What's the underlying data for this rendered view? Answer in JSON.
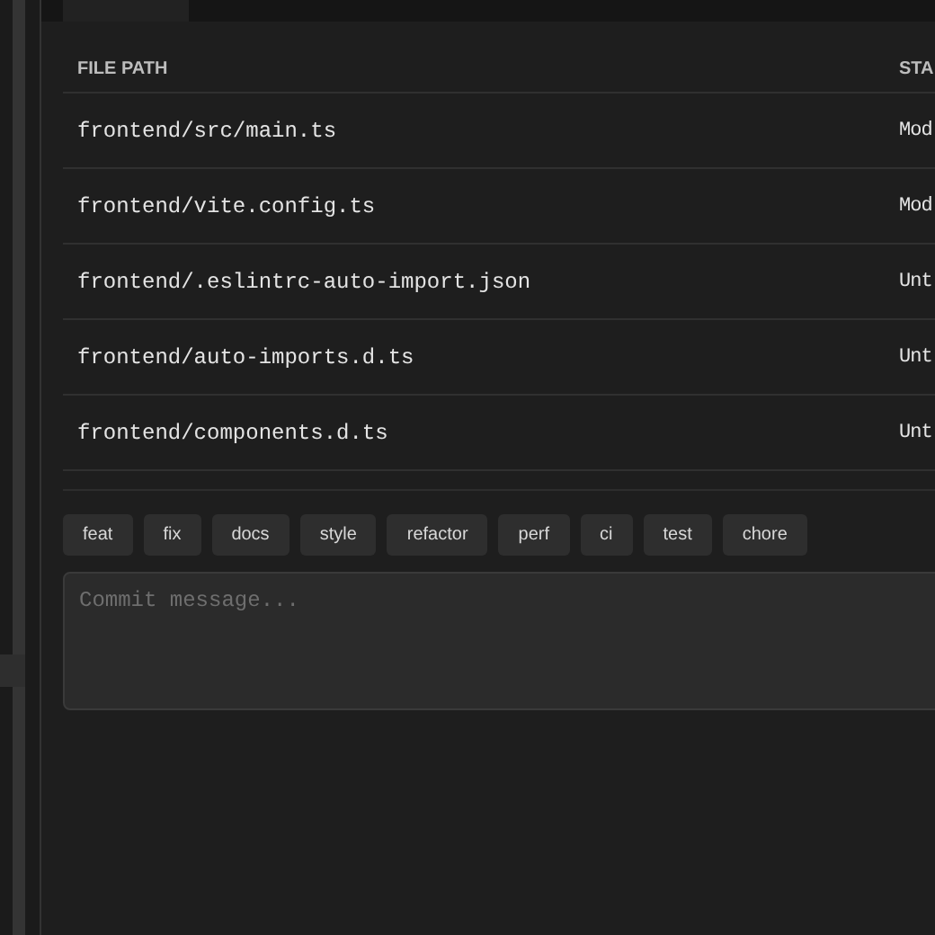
{
  "table": {
    "columns": [
      "FILE PATH",
      "STA"
    ],
    "rows": [
      {
        "path": "frontend/src/main.ts",
        "status": "Mod"
      },
      {
        "path": "frontend/vite.config.ts",
        "status": "Mod"
      },
      {
        "path": "frontend/.eslintrc-auto-import.json",
        "status": "Unt"
      },
      {
        "path": "frontend/auto-imports.d.ts",
        "status": "Unt"
      },
      {
        "path": "frontend/components.d.ts",
        "status": "Unt"
      }
    ]
  },
  "commit_types": [
    "feat",
    "fix",
    "docs",
    "style",
    "refactor",
    "perf",
    "ci",
    "test",
    "chore"
  ],
  "commit_message": {
    "placeholder": "Commit message..."
  }
}
